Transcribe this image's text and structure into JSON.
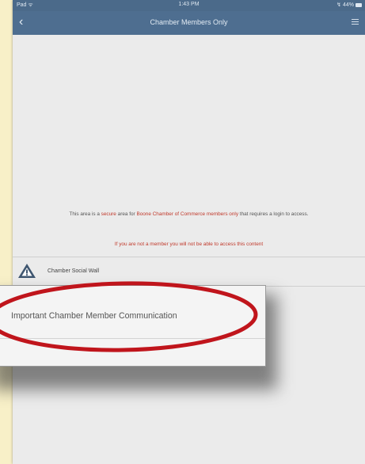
{
  "statusbar": {
    "carrier": "Pad ᯤ",
    "time": "1:43 PM",
    "battery": "↯ 44%"
  },
  "navbar": {
    "back": "‹",
    "title": "Chamber Members Only"
  },
  "notice": {
    "p1": "This area is a ",
    "secure": "secure",
    "p2": " area for ",
    "org": "Boone Chamber of Commerce members only",
    "p3": " that requires a login to access."
  },
  "warning": "If you are not a member you will not be able to access this content",
  "menu_items": [
    {
      "label": "Chamber Social Wall",
      "icon": "warning-triangle-icon"
    }
  ],
  "popup": {
    "label": "Important Chamber Member Communication"
  },
  "colors": {
    "navbar": "#4e6e90",
    "highlight_ellipse": "#c0151c",
    "warning_text": "#c0392b"
  }
}
